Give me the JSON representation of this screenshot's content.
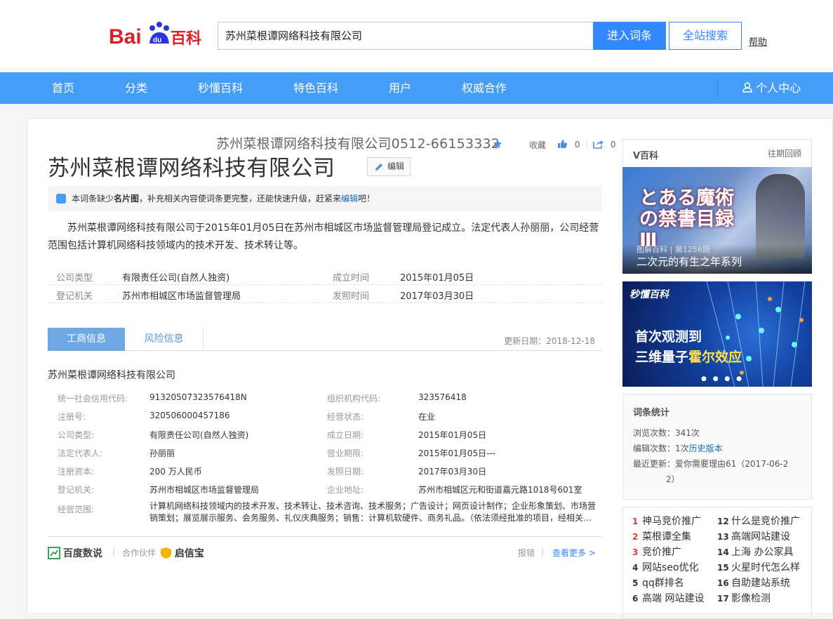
{
  "header": {
    "search_value": "苏州菜根谭网络科技有限公司",
    "enter_label": "进入词条",
    "all_search_label": "全站搜索",
    "help_label": "帮助"
  },
  "nav": {
    "items": [
      "首页",
      "分类",
      "秒懂百科",
      "特色百科",
      "用户",
      "权威合作"
    ],
    "user_center": "个人中心"
  },
  "watermark": "苏州菜根谭网络科技有限公司0512-66153332",
  "tools": {
    "collect": "收藏",
    "like_count": "0",
    "share_count": "0"
  },
  "title": "苏州菜根谭网络科技有限公司",
  "edit_label": "编辑",
  "notice": {
    "pre": "本词条缺少",
    "bold": "名片图",
    "mid": "，补充相关内容使词条更完整，还能快速升级，赶紧来",
    "link": "编辑",
    "post": "吧！"
  },
  "intro": "苏州菜根谭网络科技有限公司于2015年01月05日在苏州市相城区市场监督管理局登记成立。法定代表人孙丽丽，公司经营范围包括计算机网络科技领域内的技术开发、技术转让等。",
  "basic": [
    {
      "l1": "公司类型",
      "v1": "有限责任公司(自然人独资)",
      "l2": "成立时间",
      "v2": "2015年01月05日"
    },
    {
      "l1": "登记机关",
      "v1": "苏州市相城区市场监督管理局",
      "l2": "发照时间",
      "v2": "2017年03月30日"
    }
  ],
  "tabs": {
    "tab1": "工商信息",
    "tab2": "风险信息",
    "updated": "更新日期：2018-12-18"
  },
  "company_name": "苏州菜根谭网络科技有限公司",
  "info": [
    {
      "l1": "统一社会信用代码:",
      "v1": "91320507323576418N",
      "l2": "组织机构代码:",
      "v2": "323576418"
    },
    {
      "l1": "注册号:",
      "v1": "320506000457186",
      "l2": "经营状态:",
      "v2": "在业"
    },
    {
      "l1": "公司类型:",
      "v1": "有限责任公司(自然人独资)",
      "l2": "成立日期:",
      "v2": "2015年01月05日"
    },
    {
      "l1": "法定代表人:",
      "v1": "孙丽丽",
      "l2": "营业期限:",
      "v2": "2015年01月05日---"
    },
    {
      "l1": "注册资本:",
      "v1": "200 万人民币",
      "l2": "发照日期:",
      "v2": "2017年03月30日"
    },
    {
      "l1": "登记机关:",
      "v1": "苏州市相城区市场监督管理局",
      "l2": "企业地址:",
      "v2": "苏州市相城区元和街道嘉元路1018号601室"
    }
  ],
  "scope_label": "经营范围:",
  "scope": "计算机网络科技领域内的技术开发、技术转让、技术咨询、技术服务；广告设计；网页设计制作；企业形象策划、市场营销策划；展览展示服务、会务服务、礼仪庆典服务；销售：计算机软硬件、商务礼品。（依法须经批准的项目，经相关…",
  "footer": {
    "brand": "百度数说",
    "partner": "合作伙伴",
    "partner_name": "启信宝",
    "report": "报错",
    "more": "查看更多 >"
  },
  "side": {
    "v_title": "V百科",
    "v_past": "往期回顾",
    "img1_tag": "图解百科 | 第1256期",
    "img1_caption": "二次元的有生之年系列",
    "img1_art": "とある魔術の禁書目録Ⅲ",
    "img2_brand": "秒懂百科",
    "img2_line1": "首次观测到",
    "img2_line2a": "三维量子",
    "img2_line2b": "霍尔效应",
    "stats_title": "词条统计",
    "views_label": "浏览次数：",
    "views": "341次",
    "edits_label": "编辑次数：",
    "edits": "1次",
    "history": "历史版本",
    "updated_label": "最近更新：",
    "updated": "爱你需要理由61（2017-06-2",
    "updated2": "2）"
  },
  "rank": [
    {
      "n": "1",
      "t": "神马竞价推广"
    },
    {
      "n": "2",
      "t": "菜根谭全集"
    },
    {
      "n": "3",
      "t": "竞价推广"
    },
    {
      "n": "4",
      "t": "网站seo优化"
    },
    {
      "n": "5",
      "t": "qq群排名"
    },
    {
      "n": "6",
      "t": "高端 网站建设"
    },
    {
      "n": "12",
      "t": "什么是竞价推广"
    },
    {
      "n": "13",
      "t": "高端网站建设"
    },
    {
      "n": "14",
      "t": "上海 办公家具"
    },
    {
      "n": "15",
      "t": "火星时代怎么样"
    },
    {
      "n": "16",
      "t": "自助建站系统"
    },
    {
      "n": "17",
      "t": "影像检测"
    }
  ],
  "colors": {
    "accent": "#459df5",
    "button": "#3388ff",
    "logo_red": "#de1f26",
    "logo_blue": "#2d35d8"
  }
}
